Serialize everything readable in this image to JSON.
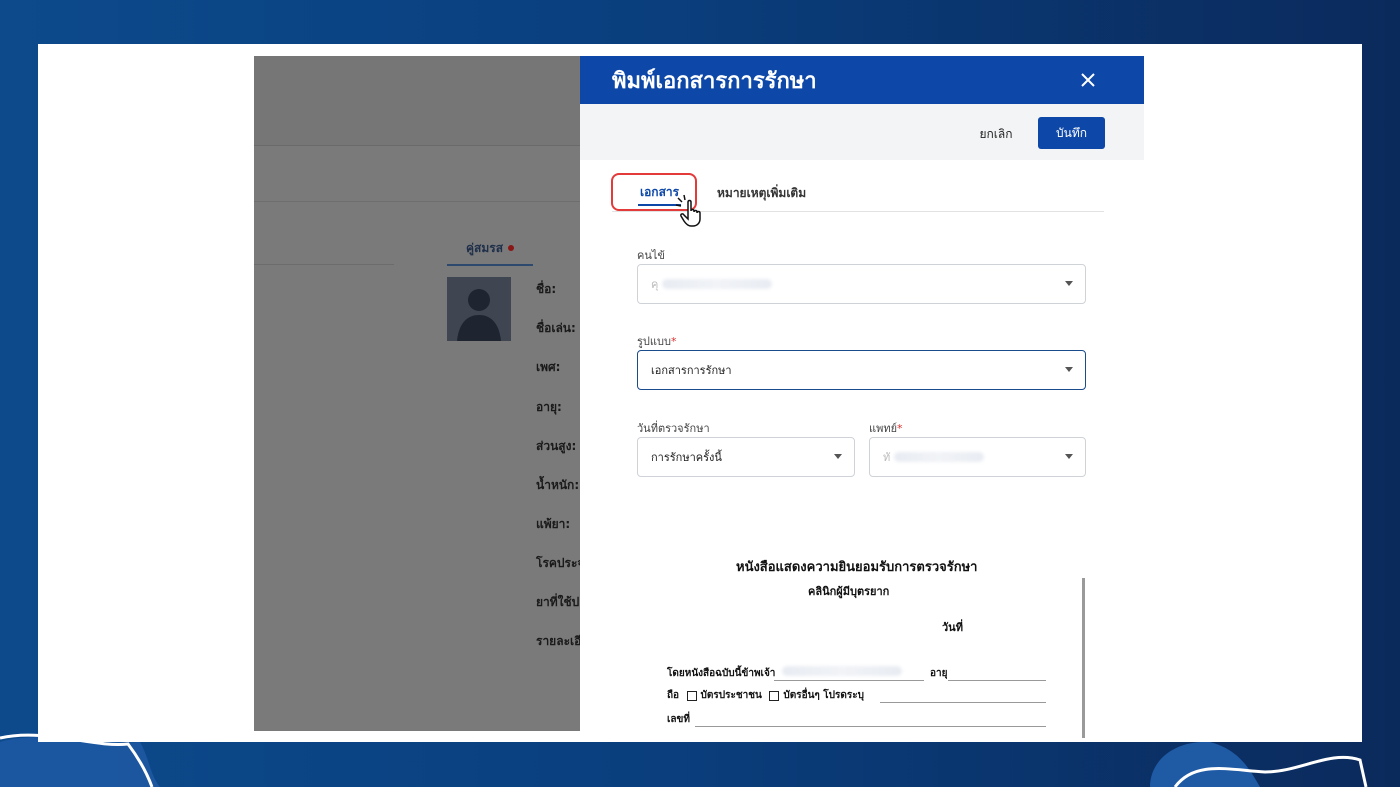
{
  "colors": {
    "primary": "#0d47a8",
    "highlight": "#e33a3a",
    "required": "#e03030"
  },
  "background_app": {
    "spouse_tab": "คู่สมรส",
    "fields": [
      "ชื่อ:",
      "ชื่อเล่น:",
      "เพศ:",
      "อายุ:",
      "ส่วนสูง:",
      "น้ำหนัก:",
      "แพ้ยา:",
      "โรคประจ",
      "ยาที่ใช้ป",
      "รายละเอี"
    ]
  },
  "modal": {
    "title": "พิมพ์เอกสารการรักษา",
    "close_icon": "close-icon",
    "cancel_label": "ยกเลิก",
    "save_label": "บันทึก",
    "tabs": [
      {
        "label": "เอกสาร",
        "active": true
      },
      {
        "label": "หมายเหตุเพิ่มเติม",
        "active": false
      }
    ],
    "patient": {
      "label": "คนไข้",
      "value_prefix": "คุ"
    },
    "format": {
      "label": "รูปแบบ",
      "required_mark": "*",
      "value": "เอกสารการรักษา"
    },
    "exam_date": {
      "label": "วันที่ตรวจรักษา",
      "value": "การรักษาครั้งนี้"
    },
    "doctor": {
      "label": "แพทย์",
      "required_mark": "*",
      "value_prefix": "ทั"
    }
  },
  "document": {
    "title": "หนังสือแสดงความยินยอมรับการตรวจรักษา",
    "subtitle": "คลินิกผู้มีบุตรยาก",
    "date_label": "วันที่",
    "line1_label": "โดยหนังสือฉบับนี้ข้าพเจ้า",
    "age_label": "อายุ",
    "hold_label": "ถือ",
    "id_card_label": "บัตรประชาชน",
    "other_card_label": "บัตรอื่นๆ โปรดระบุ",
    "number_label": "เลขที่"
  }
}
